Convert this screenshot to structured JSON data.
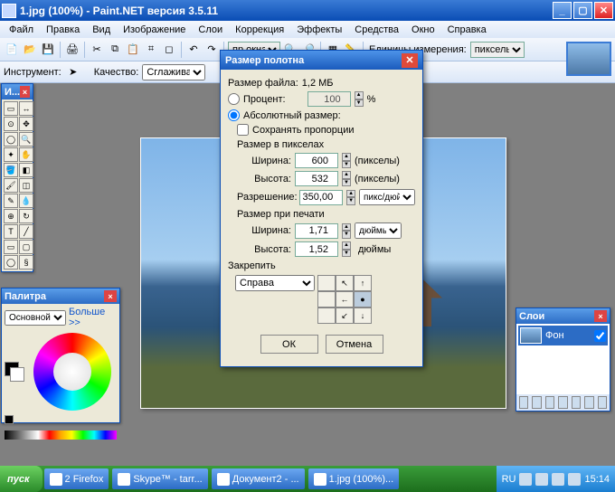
{
  "titlebar": {
    "text": "1.jpg (100%) - Paint.NET версия 3.5.11"
  },
  "menu": [
    "Файл",
    "Правка",
    "Вид",
    "Изображение",
    "Слои",
    "Коррекция",
    "Эффекты",
    "Средства",
    "Окно",
    "Справка"
  ],
  "toolbar": {
    "fit_label": "пр.окна",
    "units_label": "Единицы измерения:",
    "units_value": "пикселы"
  },
  "toolrow2": {
    "instrument_label": "Инструмент:",
    "quality_label": "Качество:",
    "quality_value": "Сглажива..."
  },
  "tools_panel": {
    "title": "И..."
  },
  "palette": {
    "title": "Палитра",
    "mode": "Основной",
    "more": "Больше >>"
  },
  "layers": {
    "title": "Слои",
    "bg_label": "Фон"
  },
  "dialog": {
    "title": "Размер полотна",
    "filesize_label": "Размер файла:",
    "filesize_value": "1,2 МБ",
    "percent_label": "Процент:",
    "percent_value": "100",
    "percent_unit": "%",
    "abs_label": "Абсолютный размер:",
    "keep_ratio": "Сохранять пропорции",
    "px_section": "Размер в пикселах",
    "width_label": "Ширина:",
    "width_px": "600",
    "height_label": "Высота:",
    "height_px": "532",
    "res_label": "Разрешение:",
    "res_val": "350,00",
    "px_unit": "(пикселы)",
    "res_unit": "пикс/дюйм",
    "print_section": "Размер при печати",
    "width_in": "1,71",
    "height_in": "1,52",
    "in_unit": "дюймы",
    "anchor_label": "Закрепить",
    "anchor_value": "Справа",
    "ok": "ОК",
    "cancel": "Отмена"
  },
  "taskbar": {
    "start": "пуск",
    "tasks": [
      "2 Firefox",
      "Skype™ - tarr...",
      "Документ2 - ...",
      "1.jpg (100%)..."
    ],
    "time": "15:14",
    "lang": "RU"
  }
}
